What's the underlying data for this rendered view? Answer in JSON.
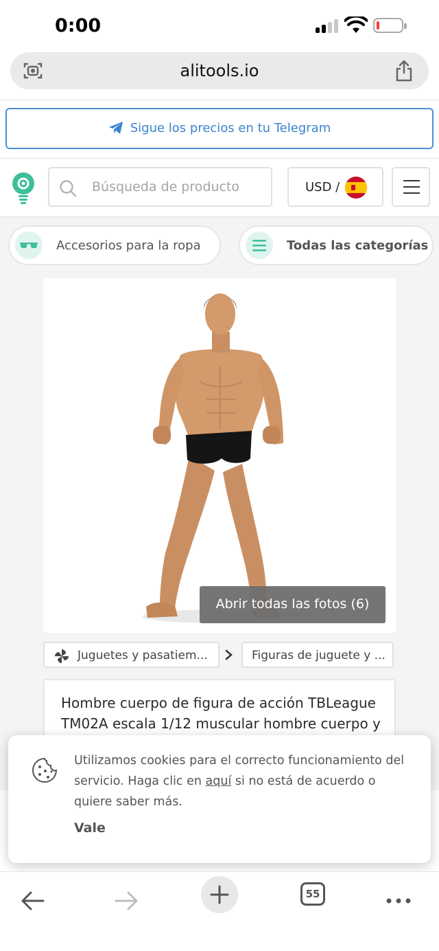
{
  "status_bar": {
    "time": "0:00"
  },
  "browser": {
    "url": "alitools.io"
  },
  "telegram_banner": {
    "label": "Sigue los precios en tu Telegram"
  },
  "header": {
    "search_placeholder": "Búsqueda de producto",
    "currency_label": "USD /"
  },
  "chips": [
    {
      "label": "Accesorios para la ropa",
      "icon": "sunglasses-icon"
    },
    {
      "label": "Todas las categorías",
      "icon": "list-icon"
    }
  ],
  "product": {
    "open_photos_label": "Abrir todas las fotos (6)",
    "title": "Hombre cuerpo de figura de acción TBLeague TM02A escala 1/12 muscular hombre cuerpo y"
  },
  "breadcrumbs": [
    {
      "label": "Juguetes y pasatiem..."
    },
    {
      "label": "Figuras de juguete y ..."
    }
  ],
  "cookie_banner": {
    "text_before": "Utilizamos cookies para el correcto funcionamiento del servicio. Haga clic en ",
    "link": "aquí",
    "text_after": " si no está de acuerdo o quiere saber más.",
    "accept_label": "Vale"
  },
  "toolbar": {
    "tab_count": "55"
  },
  "colors": {
    "accent_blue": "#3b84cf",
    "brand_teal": "#3dbf9a",
    "content_bg": "#f4f4f4"
  }
}
